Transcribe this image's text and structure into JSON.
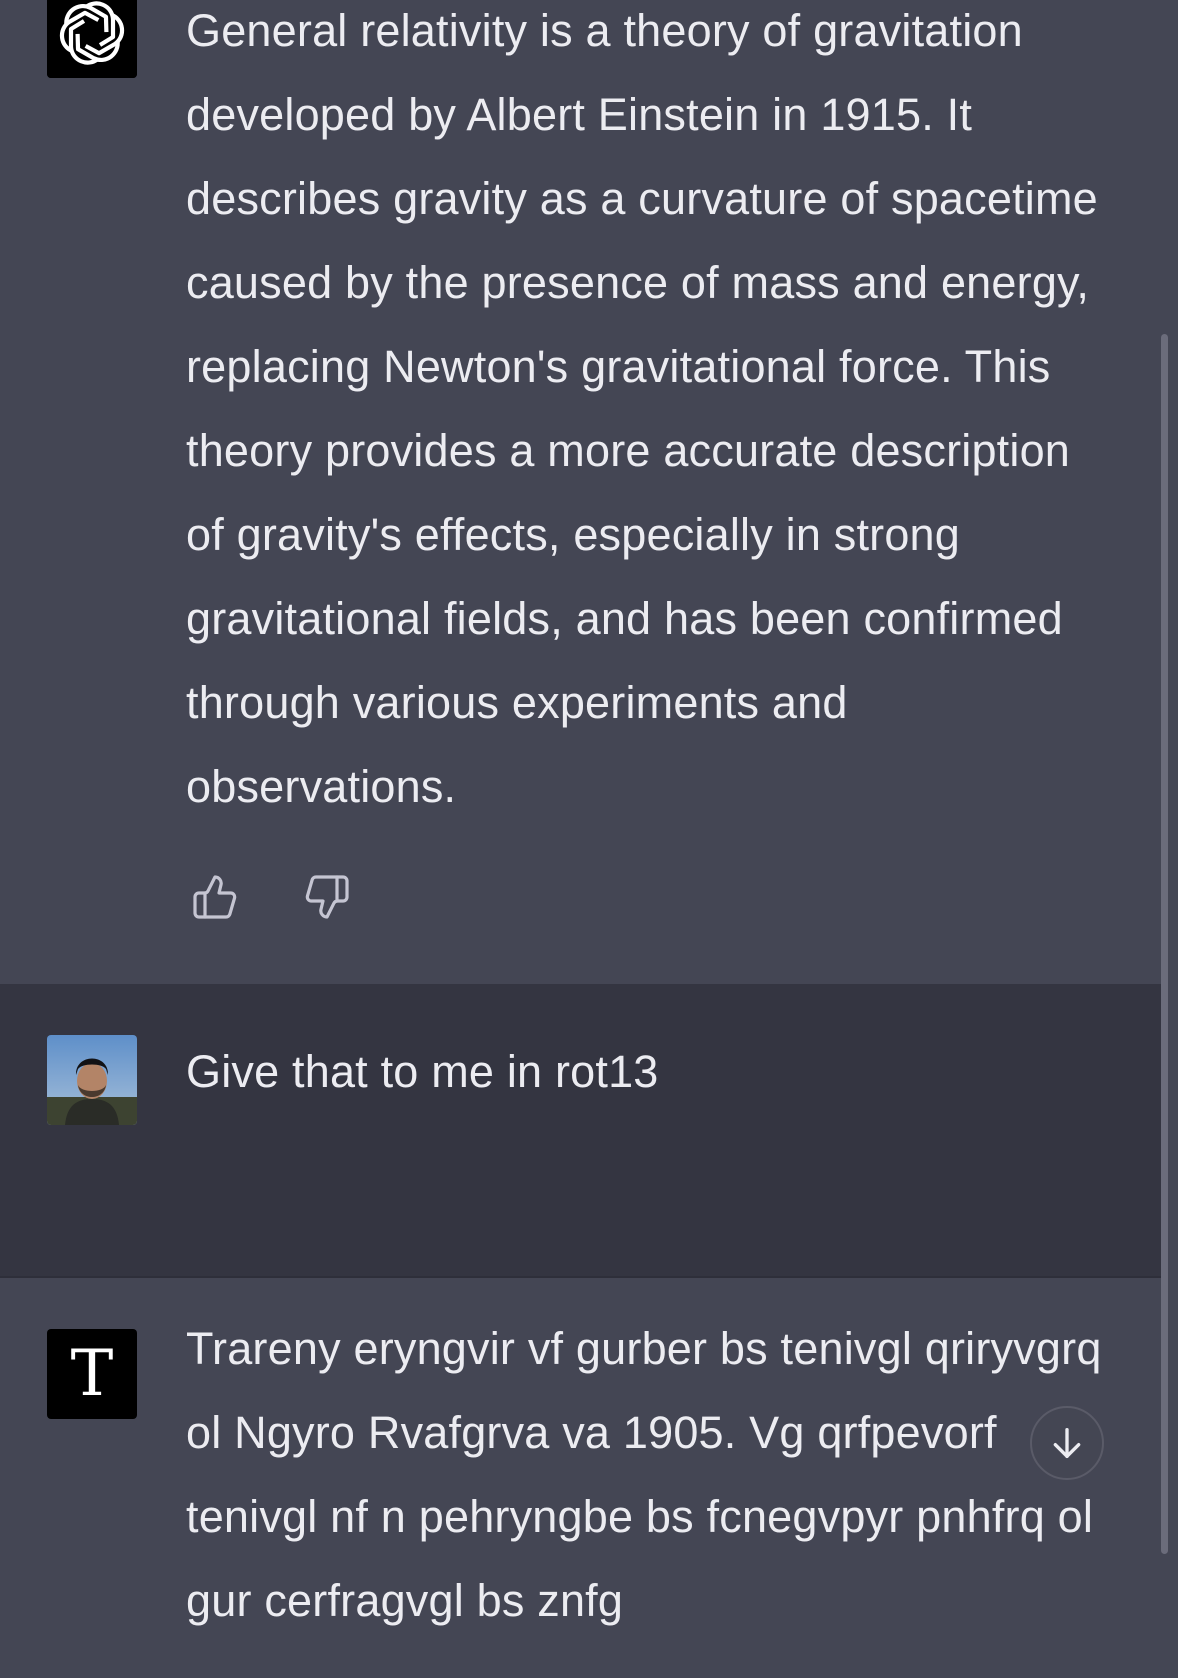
{
  "conversation": {
    "messages": [
      {
        "role": "assistant",
        "avatar_icon": "openai-logo-icon",
        "text": "General relativity is a theory of gravitation developed by Albert Einstein in 1915. It describes gravity as a curvature of spacetime caused by the presence of mass and energy, replacing Newton's gravitational force. This theory provides a more accurate description of gravity's effects, especially in strong gravitational fields, and has been confirmed through various experiments and observations."
      },
      {
        "role": "user",
        "avatar_icon": "user-photo-avatar",
        "text": "Give that to me in rot13"
      },
      {
        "role": "assistant",
        "avatar_icon": "letter-t-avatar",
        "avatar_letter": "T",
        "text": "Trareny eryngvir vf gurber bs tenivgl qriryvgrq ol Ngyro Rvafgrva va 1905. Vg qrfpevorf tenivgl nf n pehryngbe bs fcnegvpyr pnhfrq ol gur cerfragvgl bs znfg"
      }
    ]
  },
  "feedback": {
    "thumbs_up_icon": "thumbs-up-icon",
    "thumbs_down_icon": "thumbs-down-icon"
  },
  "scroll_down_icon": "arrow-down-icon",
  "colors": {
    "assistant_bg": "#444654",
    "user_bg": "#343541",
    "text": "#ECECF1",
    "icon": "#C5C5D2"
  }
}
